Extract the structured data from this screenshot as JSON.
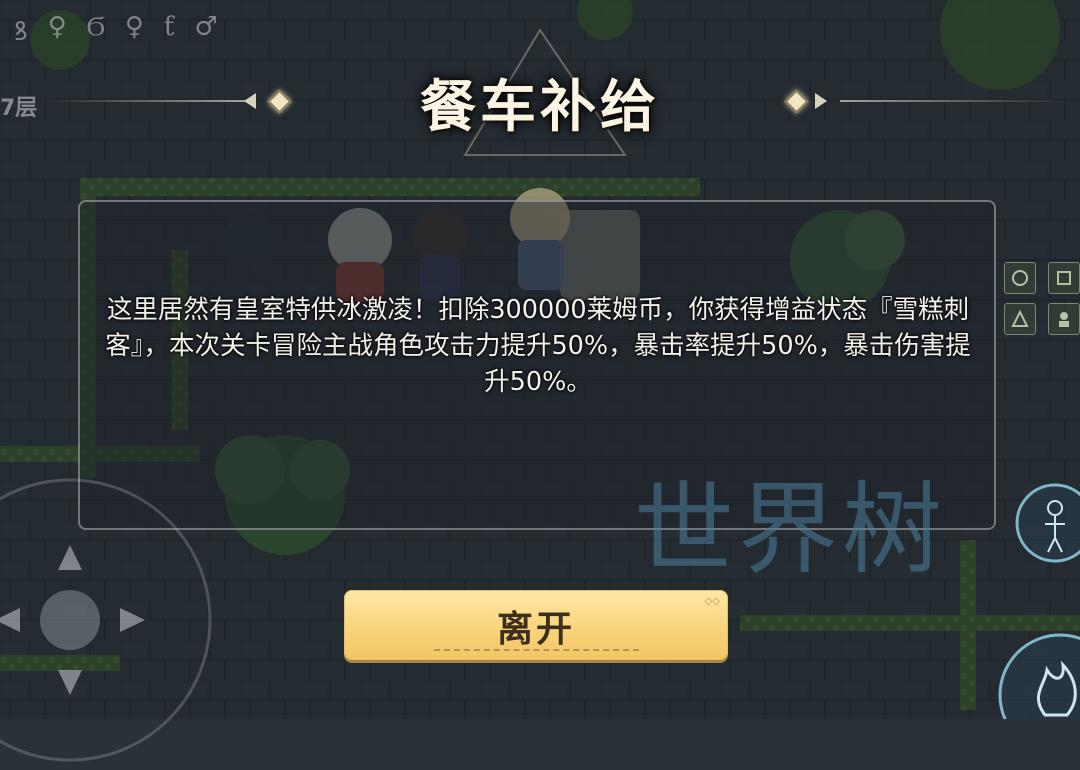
{
  "hud": {
    "floor_label": "7层",
    "glyphs": [
      "ꝸ",
      "♀",
      "Ϭ",
      "♀",
      "ƭ",
      "♂"
    ]
  },
  "dialog": {
    "title": "餐车补给",
    "message": "这里居然有皇室特供冰激凌！扣除300000莱姆币，你获得增益状态『雪糕刺客』，本次关卡冒险主战角色攻击力提升50%，暴击率提升50%，暴击伤害提升50%。",
    "leave_button": "离开"
  },
  "watermark": "世界树",
  "icons": [
    "joystick-icon",
    "character-silhouette-icon",
    "fire-skill-icon",
    "side-menu-icon"
  ],
  "colors": {
    "button": "#f9d47c",
    "title": "#fbf4e4",
    "watermark": "#4e809c"
  }
}
